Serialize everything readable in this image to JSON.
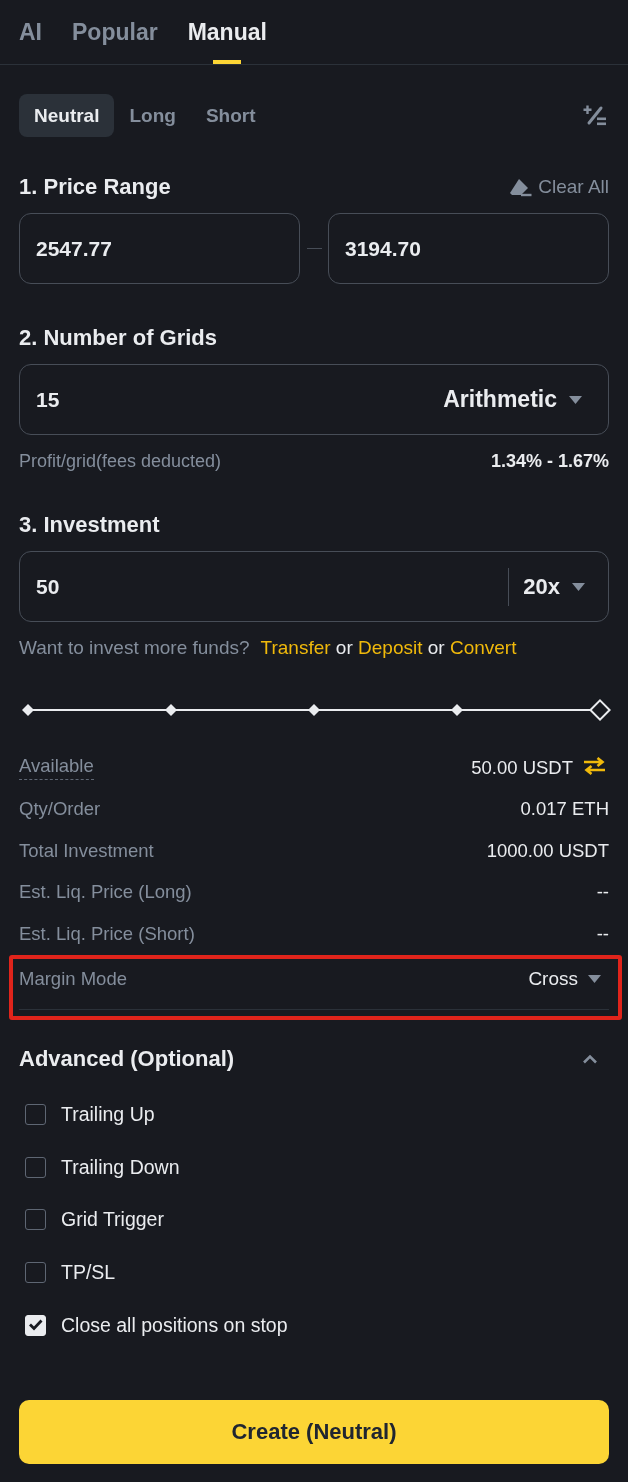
{
  "tabs": [
    {
      "label": "AI",
      "selected": false
    },
    {
      "label": "Popular",
      "selected": false
    },
    {
      "label": "Manual",
      "selected": true
    }
  ],
  "direction_tabs": [
    {
      "label": "Neutral",
      "selected": true
    },
    {
      "label": "Long",
      "selected": false
    },
    {
      "label": "Short",
      "selected": false
    }
  ],
  "price_range": {
    "title": "1. Price Range",
    "clear_label": "Clear All",
    "lower": "2547.77",
    "upper": "3194.70"
  },
  "grids": {
    "title": "2. Number of Grids",
    "value": "15",
    "type": "Arithmetic",
    "profit_label": "Profit/grid(fees deducted)",
    "profit_value": "1.34% - 1.67%"
  },
  "investment": {
    "title": "3. Investment",
    "value": "50",
    "leverage": "20x",
    "funds_line": [
      {
        "kind": "prompt",
        "text": "Want to invest more funds?"
      },
      {
        "kind": "link",
        "text": "Transfer"
      },
      {
        "kind": "joiner",
        "text": "or"
      },
      {
        "kind": "link",
        "text": "Deposit"
      },
      {
        "kind": "joiner",
        "text": "or"
      },
      {
        "kind": "link",
        "text": "Convert"
      }
    ],
    "slider": {
      "level": 1
    }
  },
  "summary": [
    {
      "kind": "balance",
      "label": "Available",
      "value": "50.00 USDT",
      "highlighted": false
    },
    {
      "kind": "info",
      "label": "Qty/Order",
      "value": "0.017 ETH",
      "highlighted": false
    },
    {
      "kind": "info",
      "label": "Total Investment",
      "value": "1000.00 USDT",
      "highlighted": false
    },
    {
      "kind": "info",
      "label": "Est. Liq. Price (Long)",
      "value": "--",
      "highlighted": false
    },
    {
      "kind": "info",
      "label": "Est. Liq. Price (Short)",
      "value": "--",
      "highlighted": false
    },
    {
      "kind": "select",
      "label": "Margin Mode",
      "value": "Cross",
      "highlighted": true
    }
  ],
  "advanced": {
    "title": "Advanced (Optional)",
    "expanded": true,
    "options": [
      {
        "label": "Trailing Up",
        "checked": false
      },
      {
        "label": "Trailing Down",
        "checked": false
      },
      {
        "label": "Grid Trigger",
        "checked": false
      },
      {
        "label": "TP/SL",
        "checked": false
      },
      {
        "label": "Close all positions on stop",
        "checked": true
      }
    ]
  },
  "create_button": {
    "label": "Create (Neutral)"
  }
}
